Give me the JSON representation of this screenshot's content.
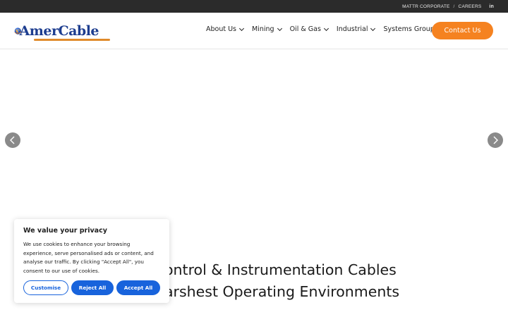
{
  "topbar": {
    "mattr_corporate": "MATTR CORPORATE",
    "separator": "/",
    "careers": "CAREERS",
    "linkedin": "in"
  },
  "header": {
    "logo_text": "AmerCable",
    "nav": [
      {
        "label": "About Us"
      },
      {
        "label": "Mining"
      },
      {
        "label": "Oil & Gas"
      },
      {
        "label": "Industrial"
      },
      {
        "label": "Systems Group"
      }
    ],
    "contact_label": "Contact Us"
  },
  "slider": {
    "prev_icon": "chevron-left-icon",
    "next_icon": "chevron-right-icon",
    "headline_line1": "ontrol & Instrumentation Cables",
    "headline_line2": "arshest Operating Environments"
  },
  "cookie": {
    "title": "We value your privacy",
    "text": "We use cookies to enhance your browsing experience, serve personalised ads or content, and analyse our traffic. By clicking \"Accept All\", you consent to our use of cookies.",
    "customise": "Customise",
    "reject": "Reject All",
    "accept": "Accept All"
  },
  "colors": {
    "accent_orange": "#f58220",
    "cookie_blue": "#1863dc",
    "topbar_bg": "#2b2b2b",
    "logo_blue": "#1d3d8f"
  }
}
